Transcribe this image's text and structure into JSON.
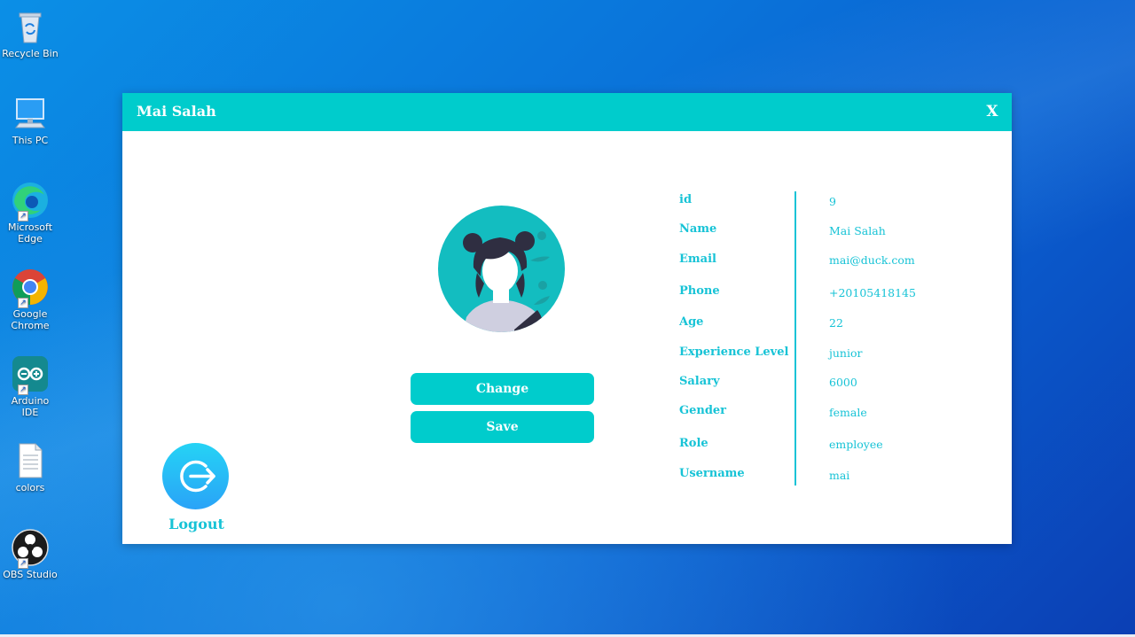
{
  "desktop": {
    "icons": [
      {
        "label": "Recycle Bin"
      },
      {
        "label": "This PC"
      },
      {
        "label": "Microsoft Edge"
      },
      {
        "label": "Google Chrome"
      },
      {
        "label": "Arduino IDE"
      },
      {
        "label": "colors"
      },
      {
        "label": "OBS Studio"
      }
    ]
  },
  "window": {
    "title": "Mai Salah",
    "close_label": "X"
  },
  "profile": {
    "change_label": "Change",
    "save_label": "Save",
    "logout_label": "Logout",
    "fields": [
      {
        "label": "id",
        "value": "9"
      },
      {
        "label": "Name",
        "value": "Mai Salah"
      },
      {
        "label": "Email",
        "value": "mai@duck.com"
      },
      {
        "label": "Phone",
        "value": "+20105418145"
      },
      {
        "label": "Age",
        "value": "22"
      },
      {
        "label": "Experience Level",
        "value": "junior"
      },
      {
        "label": "Salary",
        "value": "6000"
      },
      {
        "label": "Gender",
        "value": "female"
      },
      {
        "label": "Role",
        "value": "employee"
      },
      {
        "label": "Username",
        "value": "mai"
      }
    ]
  },
  "colors": {
    "accent": "#00cccc",
    "label_text": "#17c3d6",
    "logout_gradient_top": "#25d3f5",
    "logout_gradient_bottom": "#2aa3f7"
  },
  "icons": {
    "avatar": "user-avatar-icon",
    "logout": "logout-arrow-icon"
  }
}
